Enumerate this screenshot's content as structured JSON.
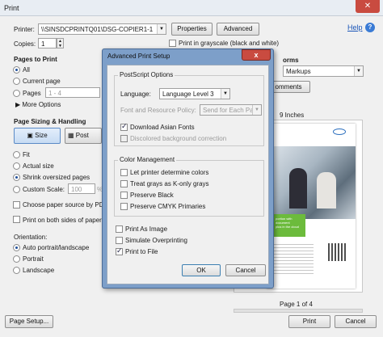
{
  "window": {
    "title": "Print",
    "help": "Help"
  },
  "printer": {
    "label": "Printer:",
    "value": "\\\\SINSDCPRINTQ01\\DSG-COPIER1-1",
    "properties": "Properties",
    "advanced": "Advanced"
  },
  "copies": {
    "label": "Copies:",
    "value": "1"
  },
  "grayscale": {
    "label": "Print in grayscale (black and white)"
  },
  "pages_to_print": {
    "title": "Pages to Print",
    "all": "All",
    "current": "Current page",
    "pages": "Pages",
    "pages_value": "1 - 4",
    "more": "More Options"
  },
  "sizing": {
    "title": "Page Sizing & Handling",
    "size_btn": "Size",
    "poster_btn": "Post",
    "fit": "Fit",
    "actual": "Actual size",
    "shrink": "Shrink oversized pages",
    "custom": "Custom Scale:",
    "custom_value": "100",
    "custom_unit": "%",
    "choose_source": "Choose paper source by PDF p",
    "both_sides": "Print on both sides of paper"
  },
  "orientation": {
    "title": "Orientation:",
    "auto": "Auto portrait/landscape",
    "portrait": "Portrait",
    "landscape": "Landscape"
  },
  "right_panel": {
    "comments_title": "orms",
    "markups": "Markups",
    "comments_btn": "omments",
    "size_label": "9 Inches",
    "page_info": "Page 1 of 4",
    "preview_text": "portion with document\nplus in the cloud"
  },
  "bottom": {
    "page_setup": "Page Setup...",
    "print": "Print",
    "cancel": "Cancel"
  },
  "dialog": {
    "title": "Advanced Print Setup",
    "close": "x",
    "postscript_title": "PostScript Options",
    "language_label": "Language:",
    "language_value": "Language Level 3",
    "font_policy_label": "Font and Resource Policy:",
    "font_policy_value": "Send for Each Page",
    "download_fonts": "Download Asian Fonts",
    "discolored_bg": "Discolored background correction",
    "color_mgmt_title": "Color Management",
    "let_printer": "Let printer determine colors",
    "treat_grays": "Treat grays as K-only grays",
    "preserve_black": "Preserve Black",
    "preserve_cmyk": "Preserve CMYK Primaries",
    "print_as_image": "Print As Image",
    "simulate_overprint": "Simulate Overprinting",
    "print_to_file": "Print to File",
    "ok": "OK",
    "cancel": "Cancel"
  },
  "colors": {
    "dialog_title_bar": "#6b8fbf",
    "close_button": "#c94b40",
    "dialog_bg": "#f0f0f0",
    "link": "#1a55b8",
    "green_panel": "#6cbb3c"
  }
}
